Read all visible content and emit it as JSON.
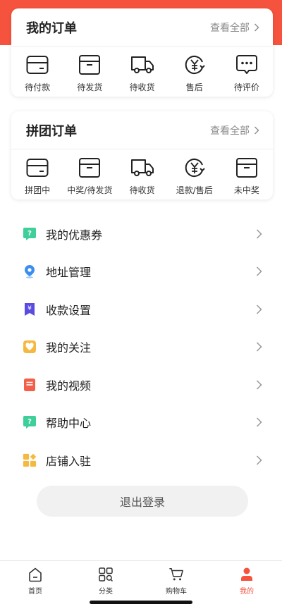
{
  "orders": {
    "title": "我的订单",
    "more": "查看全部",
    "items": [
      {
        "label": "待付款",
        "icon": "card-icon"
      },
      {
        "label": "待发货",
        "icon": "box-icon"
      },
      {
        "label": "待收货",
        "icon": "truck-icon"
      },
      {
        "label": "售后",
        "icon": "refund-icon"
      },
      {
        "label": "待评价",
        "icon": "comment-icon"
      }
    ]
  },
  "group_orders": {
    "title": "拼团订单",
    "more": "查看全部",
    "items": [
      {
        "label": "拼团中",
        "icon": "card-icon"
      },
      {
        "label": "中奖/待发货",
        "icon": "box-icon"
      },
      {
        "label": "待收货",
        "icon": "truck-icon"
      },
      {
        "label": "退款/售后",
        "icon": "refund-icon"
      },
      {
        "label": "未中奖",
        "icon": "box-icon"
      }
    ]
  },
  "menu": [
    {
      "label": "我的优惠券",
      "icon": "coupon-icon",
      "color": "#3ecf9a"
    },
    {
      "label": "地址管理",
      "icon": "location-icon",
      "color": "#3a8ef0"
    },
    {
      "label": "收款设置",
      "icon": "payment-icon",
      "color": "#5b4be0"
    },
    {
      "label": "我的关注",
      "icon": "heart-icon",
      "color": "#f5b942"
    },
    {
      "label": "我的视频",
      "icon": "video-icon",
      "color": "#f2604a"
    },
    {
      "label": "帮助中心",
      "icon": "help-icon",
      "color": "#3ecf9a"
    },
    {
      "label": "店铺入驻",
      "icon": "store-icon",
      "color": "#f5b942"
    }
  ],
  "logout_label": "退出登录",
  "tabbar": [
    {
      "label": "首页",
      "icon": "home-icon",
      "active": false
    },
    {
      "label": "分类",
      "icon": "category-icon",
      "active": false
    },
    {
      "label": "购物车",
      "icon": "cart-icon",
      "active": false
    },
    {
      "label": "我的",
      "icon": "profile-icon",
      "active": true
    }
  ],
  "colors": {
    "accent": "#f5533d"
  }
}
